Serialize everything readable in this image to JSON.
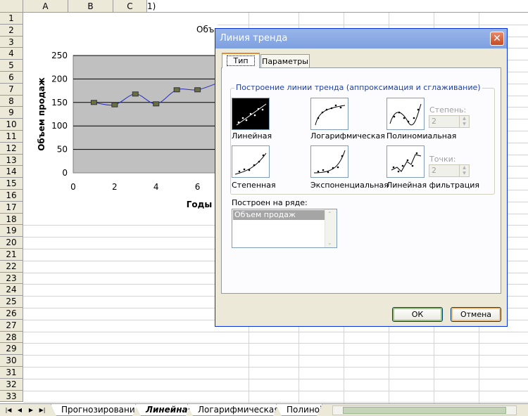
{
  "sheet": {
    "columns": [
      "A",
      "B",
      "C"
    ],
    "rows": [
      "1",
      "2",
      "3",
      "4",
      "5",
      "6",
      "7",
      "8",
      "9",
      "10",
      "11",
      "12",
      "13",
      "14",
      "15",
      "16",
      "17",
      "18",
      "19",
      "20",
      "21",
      "22",
      "23",
      "24",
      "25",
      "26",
      "27",
      "28",
      "29",
      "30",
      "31",
      "32",
      "33"
    ],
    "cell_d1": "1)"
  },
  "chart": {
    "title_fragment": "Объ",
    "ylabel": "Объем продаж",
    "xlabel": "Годы",
    "yticks": [
      "0",
      "50",
      "100",
      "150",
      "200",
      "250"
    ],
    "xticks": [
      "0",
      "2",
      "4",
      "6"
    ],
    "colors": {
      "plot_bg": "#c0c0c0",
      "line": "#2b2bc8",
      "marker": "#6b7040"
    }
  },
  "chart_data": {
    "type": "line",
    "series": [
      {
        "values": [
          150,
          145,
          168,
          147,
          177,
          177,
          192
        ]
      }
    ],
    "x": [
      1,
      2,
      3,
      4,
      5,
      6,
      7
    ],
    "xlabel": "Годы",
    "ylabel": "Объем продаж",
    "xlim": [
      0,
      7.1
    ],
    "ylim": [
      0,
      250
    ],
    "grid": true
  },
  "dialog": {
    "title": "Линия тренда",
    "close_glyph": "✕",
    "tabs": [
      {
        "label": "Тип"
      },
      {
        "label": "Параметры"
      }
    ],
    "group_label": "Построение линии тренда (аппроксимация и сглаживание)",
    "types": [
      {
        "label": "Линейная"
      },
      {
        "label": "Логарифмическая"
      },
      {
        "label": "Полиномиальная"
      },
      {
        "label": "Степенная"
      },
      {
        "label": "Экспоненциальная"
      },
      {
        "label": "Линейная фильтрация"
      }
    ],
    "degree_label": "Степень:",
    "degree_value": "2",
    "points_label": "Точки:",
    "points_value": "2",
    "series_label": "Построен на ряде:",
    "series_items": [
      "Объем продаж"
    ],
    "ok_label": "ОК",
    "cancel_label": "Отмена"
  },
  "sheet_tabs": [
    {
      "label": "Прогнозирование"
    },
    {
      "label": "Линейная"
    },
    {
      "label": "Логарифмическая"
    },
    {
      "label": "Полиноі"
    }
  ]
}
